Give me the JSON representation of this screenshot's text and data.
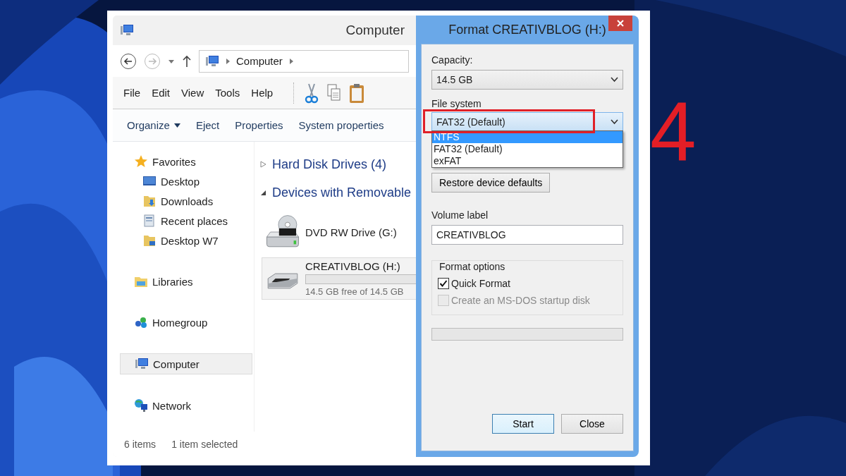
{
  "explorer": {
    "title": "Computer",
    "address": {
      "crumbs": [
        "Computer"
      ]
    },
    "menu": [
      "File",
      "Edit",
      "View",
      "Tools",
      "Help"
    ],
    "toolbar": [
      {
        "label": "Organize",
        "dropdown": true
      },
      {
        "label": "Eject",
        "dropdown": false
      },
      {
        "label": "Properties",
        "dropdown": false
      },
      {
        "label": "System properties",
        "dropdown": false
      }
    ],
    "nav": [
      {
        "label": "Favorites",
        "kind": "star",
        "selected": false,
        "children": [
          {
            "label": "Desktop",
            "kind": "desktop",
            "selected": false
          },
          {
            "label": "Downloads",
            "kind": "downloads",
            "selected": false
          },
          {
            "label": "Recent places",
            "kind": "recent",
            "selected": false
          },
          {
            "label": "Desktop W7",
            "kind": "folder",
            "selected": false
          }
        ]
      },
      {
        "label": "Libraries",
        "kind": "libraries",
        "selected": false
      },
      {
        "label": "Homegroup",
        "kind": "homegroup",
        "selected": false
      },
      {
        "label": "Computer",
        "kind": "computer",
        "selected": true
      },
      {
        "label": "Network",
        "kind": "network",
        "selected": false
      }
    ],
    "groups": [
      {
        "label": "Hard Disk Drives (4)",
        "expanded": false
      },
      {
        "label": "Devices with Removable",
        "expanded": true
      }
    ],
    "drives": [
      {
        "name": "DVD RW Drive (G:)",
        "kind": "dvd",
        "selected": false
      },
      {
        "name": "CREATIVBLOG (H:)",
        "kind": "usb",
        "selected": true,
        "free": "14.5 GB free of 14.5 GB"
      }
    ],
    "status": [
      "6 items",
      "1 item selected"
    ]
  },
  "dialog": {
    "title": "Format CREATIVBLOG (H:)",
    "capacity": {
      "label": "Capacity:",
      "value": "14.5 GB"
    },
    "file_system": {
      "label": "File system",
      "value": "FAT32 (Default)",
      "expanded": true,
      "options": [
        {
          "label": "NTFS",
          "highlighted": true
        },
        {
          "label": "FAT32 (Default)",
          "highlighted": false
        },
        {
          "label": "exFAT",
          "highlighted": false
        }
      ]
    },
    "restore_button": "Restore device defaults",
    "volume_label": {
      "label": "Volume label",
      "value": "CREATIVBLOG"
    },
    "format_options": {
      "title": "Format options",
      "checkboxes": [
        {
          "label": "Quick Format",
          "checked": true,
          "disabled": false
        },
        {
          "label": "Create an MS-DOS startup disk",
          "checked": false,
          "disabled": true
        }
      ]
    },
    "buttons": [
      {
        "label": "Start",
        "default": true
      },
      {
        "label": "Close",
        "default": false
      }
    ]
  },
  "annotation": {
    "step": "4"
  }
}
